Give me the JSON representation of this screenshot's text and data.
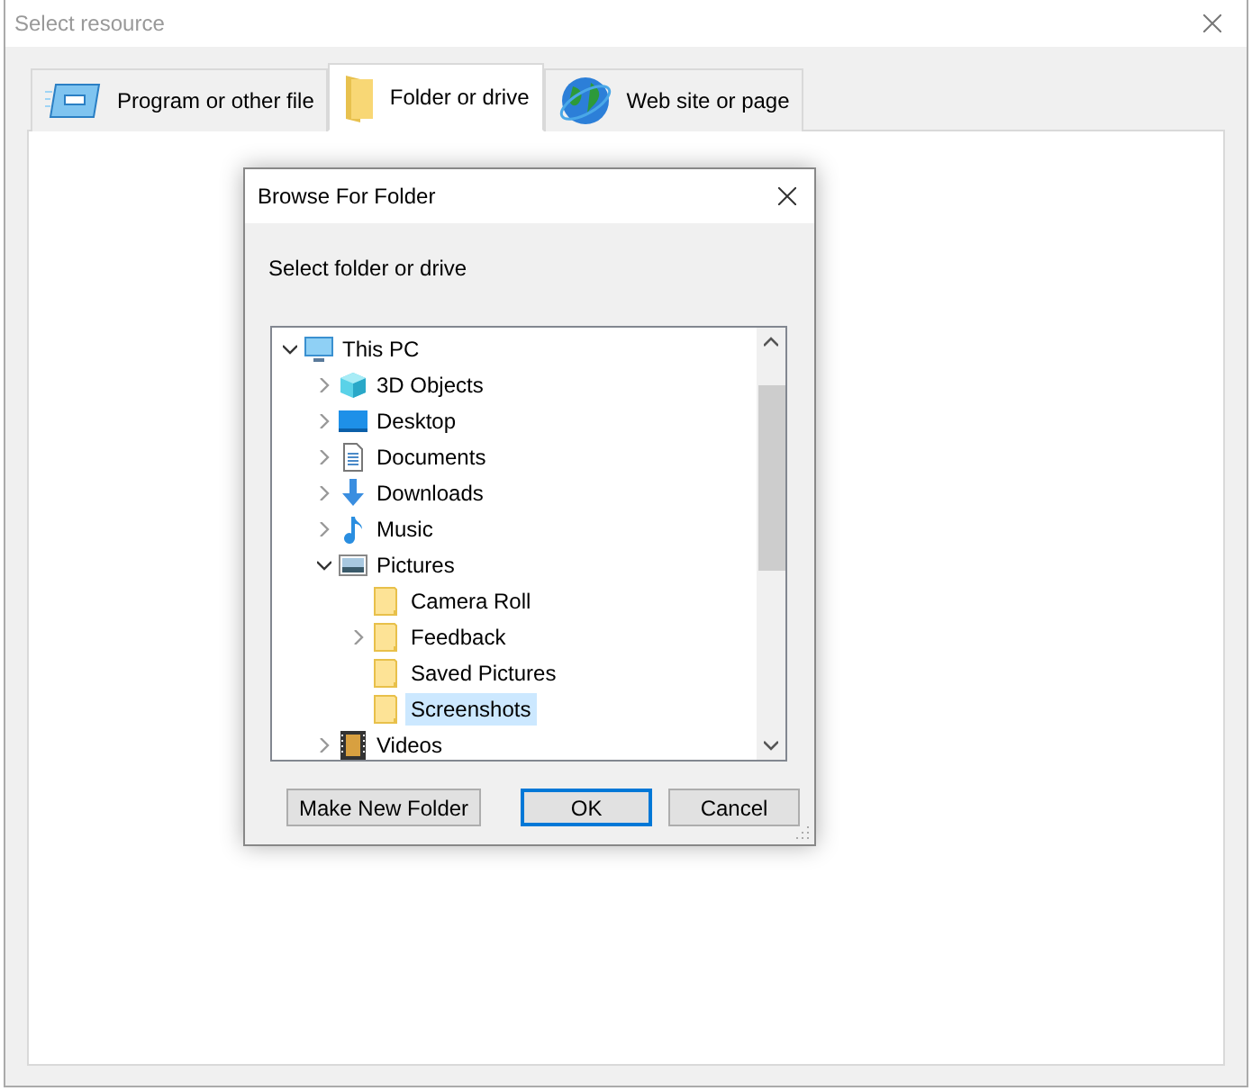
{
  "window": {
    "title": "Select resource"
  },
  "tabs": [
    {
      "label": "Program or other file",
      "kind": "program",
      "selected": false
    },
    {
      "label": "Folder or drive",
      "kind": "folder",
      "selected": true
    },
    {
      "label": "Web site or page",
      "kind": "web",
      "selected": false
    }
  ],
  "dialog": {
    "title": "Browse For Folder",
    "instruction": "Select folder or drive",
    "tree": [
      {
        "label": "This PC",
        "kind": "computer",
        "has_children": true,
        "expanded": true,
        "selected": false,
        "children": [
          {
            "label": "3D Objects",
            "kind": "cube",
            "has_children": true,
            "expanded": false,
            "selected": false
          },
          {
            "label": "Desktop",
            "kind": "desktop",
            "has_children": true,
            "expanded": false,
            "selected": false
          },
          {
            "label": "Documents",
            "kind": "document",
            "has_children": true,
            "expanded": false,
            "selected": false
          },
          {
            "label": "Downloads",
            "kind": "download",
            "has_children": true,
            "expanded": false,
            "selected": false
          },
          {
            "label": "Music",
            "kind": "music",
            "has_children": true,
            "expanded": false,
            "selected": false
          },
          {
            "label": "Pictures",
            "kind": "pictures",
            "has_children": true,
            "expanded": true,
            "selected": false,
            "children": [
              {
                "label": "Camera Roll",
                "kind": "folder",
                "has_children": false,
                "expanded": false,
                "selected": false
              },
              {
                "label": "Feedback",
                "kind": "folder",
                "has_children": true,
                "expanded": false,
                "selected": false
              },
              {
                "label": "Saved Pictures",
                "kind": "folder",
                "has_children": false,
                "expanded": false,
                "selected": false
              },
              {
                "label": "Screenshots",
                "kind": "folder",
                "has_children": false,
                "expanded": false,
                "selected": true
              }
            ]
          },
          {
            "label": "Videos",
            "kind": "video",
            "has_children": true,
            "expanded": false,
            "selected": false
          }
        ]
      }
    ],
    "buttons": [
      {
        "label": "Make New Folder",
        "default": false
      },
      {
        "label": "OK",
        "default": true
      },
      {
        "label": "Cancel",
        "default": false
      }
    ]
  }
}
